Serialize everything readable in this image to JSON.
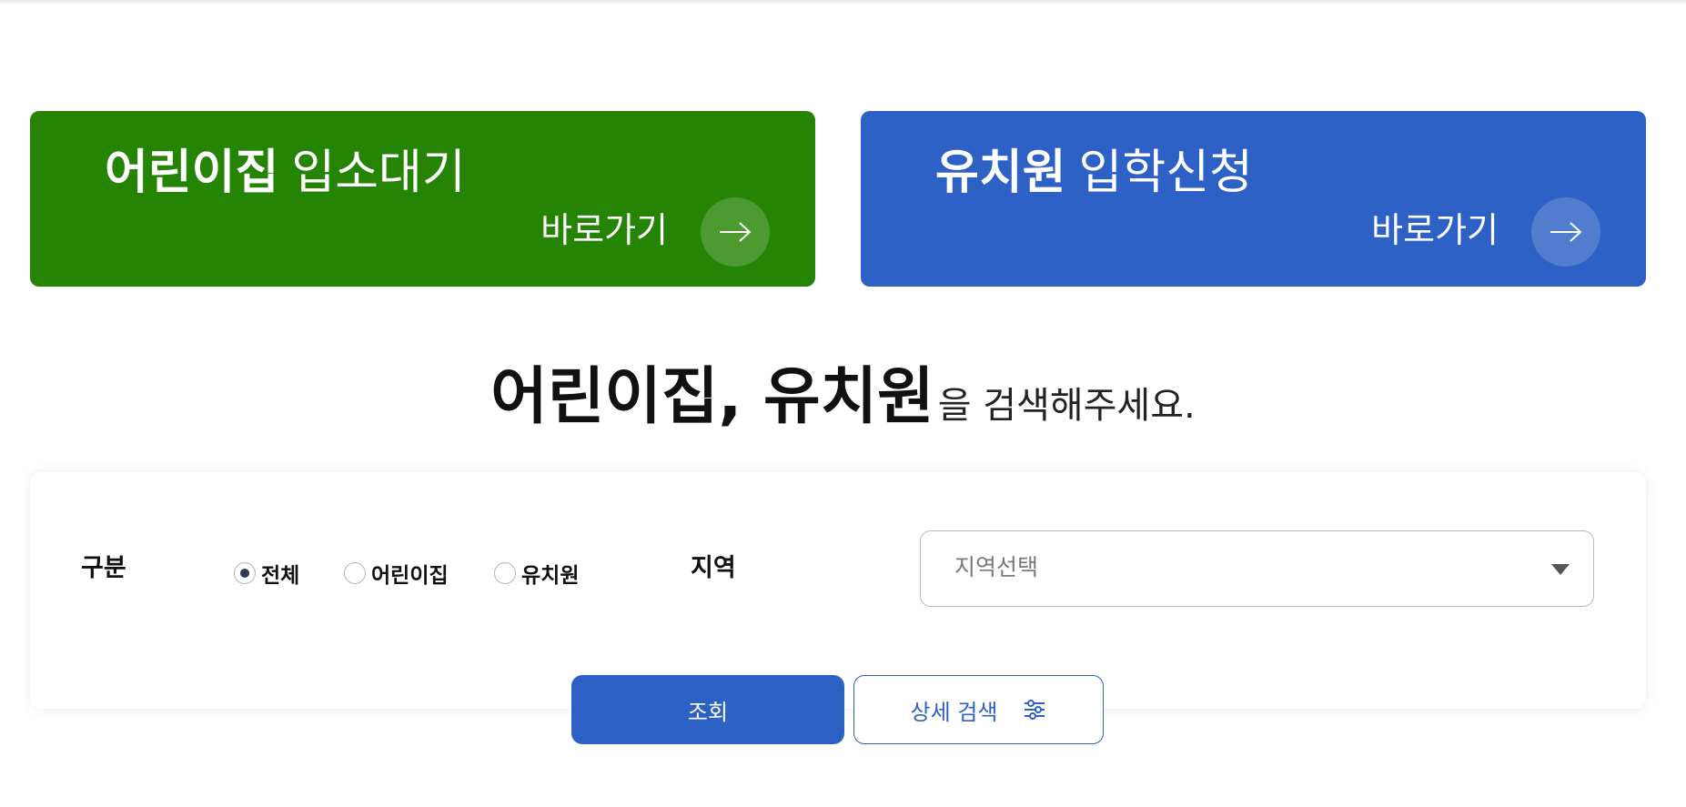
{
  "banners": [
    {
      "title_strong": "어린이집",
      "title_light": "입소대기",
      "goto_label": "바로가기",
      "color": "#258403"
    },
    {
      "title_strong": "유치원",
      "title_light": "입학신청",
      "goto_label": "바로가기",
      "color": "#2d61c5"
    }
  ],
  "heading": {
    "strong": "어린이집, 유치원",
    "light": "을 검색해주세요."
  },
  "search": {
    "type_label": "구분",
    "options": [
      {
        "label": "전체",
        "checked": true
      },
      {
        "label": "어린이집",
        "checked": false
      },
      {
        "label": "유치원",
        "checked": false
      }
    ],
    "region_label": "지역",
    "region_placeholder": "지역선택",
    "submit_label": "조회",
    "detail_label": "상세 검색",
    "accent_color": "#2d61c5"
  }
}
